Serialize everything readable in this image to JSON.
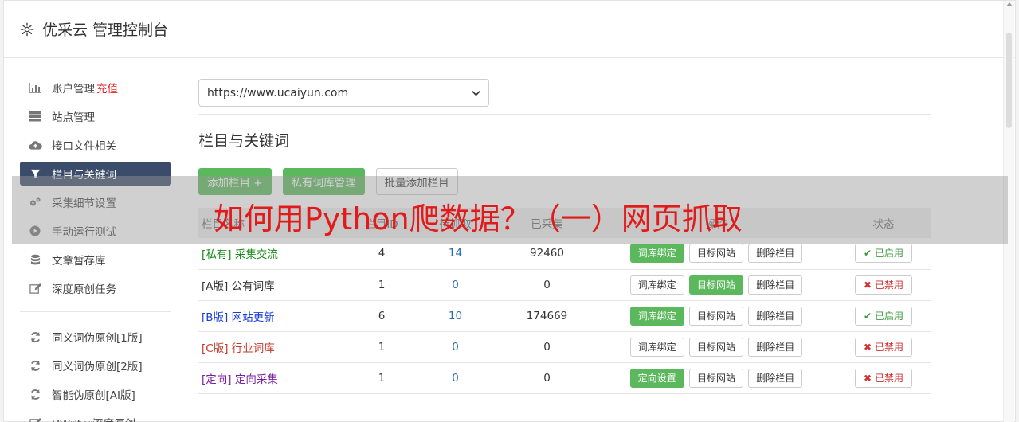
{
  "header": {
    "title": "优采云 管理控制台"
  },
  "sidebar": {
    "items": [
      {
        "label": "账户管理",
        "extra": "充值",
        "icon": "bar-chart-icon"
      },
      {
        "label": "站点管理",
        "icon": "server-icon"
      },
      {
        "label": "接口文件相关",
        "icon": "cloud-upload-icon"
      },
      {
        "label": "栏目与关键词",
        "icon": "filter-icon",
        "active": true
      },
      {
        "label": "采集细节设置",
        "icon": "cogs-icon"
      },
      {
        "label": "手动运行测试",
        "icon": "play-icon"
      },
      {
        "label": "文章暂存库",
        "icon": "database-icon"
      },
      {
        "label": "深度原创任务",
        "icon": "edit-icon"
      }
    ],
    "items2": [
      {
        "label": "同义词伪原创[1版]",
        "icon": "refresh-icon"
      },
      {
        "label": "同义词伪原创[2版]",
        "icon": "refresh-icon"
      },
      {
        "label": "智能伪原创[AI版]",
        "icon": "refresh-icon"
      },
      {
        "label": "UWriter深度原创",
        "icon": "edit-icon"
      }
    ]
  },
  "main": {
    "site_select": "https://www.ucaiyun.com",
    "section_title": "栏目与关键词",
    "buttons": {
      "add_column": "添加栏目 +",
      "private_lib": "私有词库管理",
      "batch_add": "批量添加栏目"
    },
    "table": {
      "headers": [
        "栏目名称",
        "栏目ID",
        "待抓取",
        "已采集",
        "操作",
        "状态"
      ],
      "rows": [
        {
          "tag": "[私有]",
          "name": "采集交流",
          "id": "4",
          "pending": "14",
          "collected": "92460",
          "op1": "词库绑定",
          "op2": "目标网站",
          "op3": "删除栏目",
          "status": "已启用",
          "color": "green",
          "highlight": 1,
          "enabled": true
        },
        {
          "tag": "[A版]",
          "name": "公有词库",
          "id": "1",
          "pending": "0",
          "collected": "0",
          "op1": "词库绑定",
          "op2": "目标网站",
          "op3": "删除栏目",
          "status": "已禁用",
          "color": "dark",
          "highlight": 2,
          "enabled": false
        },
        {
          "tag": "[B版]",
          "name": "网站更新",
          "id": "6",
          "pending": "10",
          "collected": "174669",
          "op1": "词库绑定",
          "op2": "目标网站",
          "op3": "删除栏目",
          "status": "已启用",
          "color": "blue",
          "highlight": 1,
          "enabled": true
        },
        {
          "tag": "[C版]",
          "name": "行业词库",
          "id": "1",
          "pending": "0",
          "collected": "0",
          "op1": "词库绑定",
          "op2": "目标网站",
          "op3": "删除栏目",
          "status": "已禁用",
          "color": "red",
          "highlight": 0,
          "enabled": false
        },
        {
          "tag": "[定向]",
          "name": "定向采集",
          "id": "1",
          "pending": "0",
          "collected": "0",
          "op1": "定向设置",
          "op2": "目标网站",
          "op3": "删除栏目",
          "status": "已禁用",
          "color": "purple",
          "highlight": 1,
          "enabled": false
        }
      ]
    }
  },
  "overlay": {
    "text": "如何用Python爬数据？（一）网页抓取"
  },
  "colors": {
    "active_nav": "#3a4c69",
    "green": "#5cb85c",
    "overlay_text": "#e21a1a"
  }
}
